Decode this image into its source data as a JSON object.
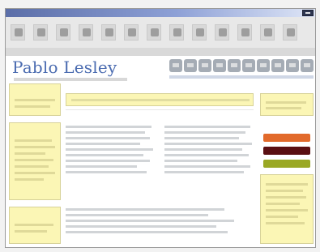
{
  "window": {
    "close_icon": "close-icon"
  },
  "toolbar": {
    "buttons": [
      {
        "icon": "back-icon"
      },
      {
        "icon": "forward-icon"
      },
      {
        "icon": "stop-icon"
      },
      {
        "icon": "refresh-icon"
      },
      {
        "icon": "home-icon"
      },
      {
        "icon": "search-icon"
      },
      {
        "icon": "favorites-icon"
      },
      {
        "icon": "history-icon"
      },
      {
        "icon": "mail-icon"
      },
      {
        "icon": "print-icon"
      },
      {
        "icon": "edit-icon"
      },
      {
        "icon": "discuss-icon"
      },
      {
        "icon": "messenger-icon"
      }
    ]
  },
  "site": {
    "logo_text": "Pablo Lesley",
    "header_icons": [
      {
        "icon": "link-icon"
      },
      {
        "icon": "link-icon"
      },
      {
        "icon": "link-icon"
      },
      {
        "icon": "link-icon"
      },
      {
        "icon": "link-icon"
      },
      {
        "icon": "link-icon"
      },
      {
        "icon": "link-icon"
      },
      {
        "icon": "link-icon"
      },
      {
        "icon": "link-icon"
      },
      {
        "icon": "link-icon"
      }
    ]
  },
  "left": {
    "section_titles": [
      "",
      "",
      ""
    ]
  },
  "main": {
    "heading": "",
    "article_titles": [
      "",
      ""
    ],
    "list_title": ""
  },
  "right": {
    "heading": ""
  },
  "colors": {
    "link_blue": "#4a6bb0",
    "yellow_panel": "#fbf6b5",
    "orange_bar": "#e26a2b",
    "dark_red_bar": "#5a0f12",
    "green_bar": "#9aa824",
    "titlebar_blue": "#5b6ea8"
  }
}
